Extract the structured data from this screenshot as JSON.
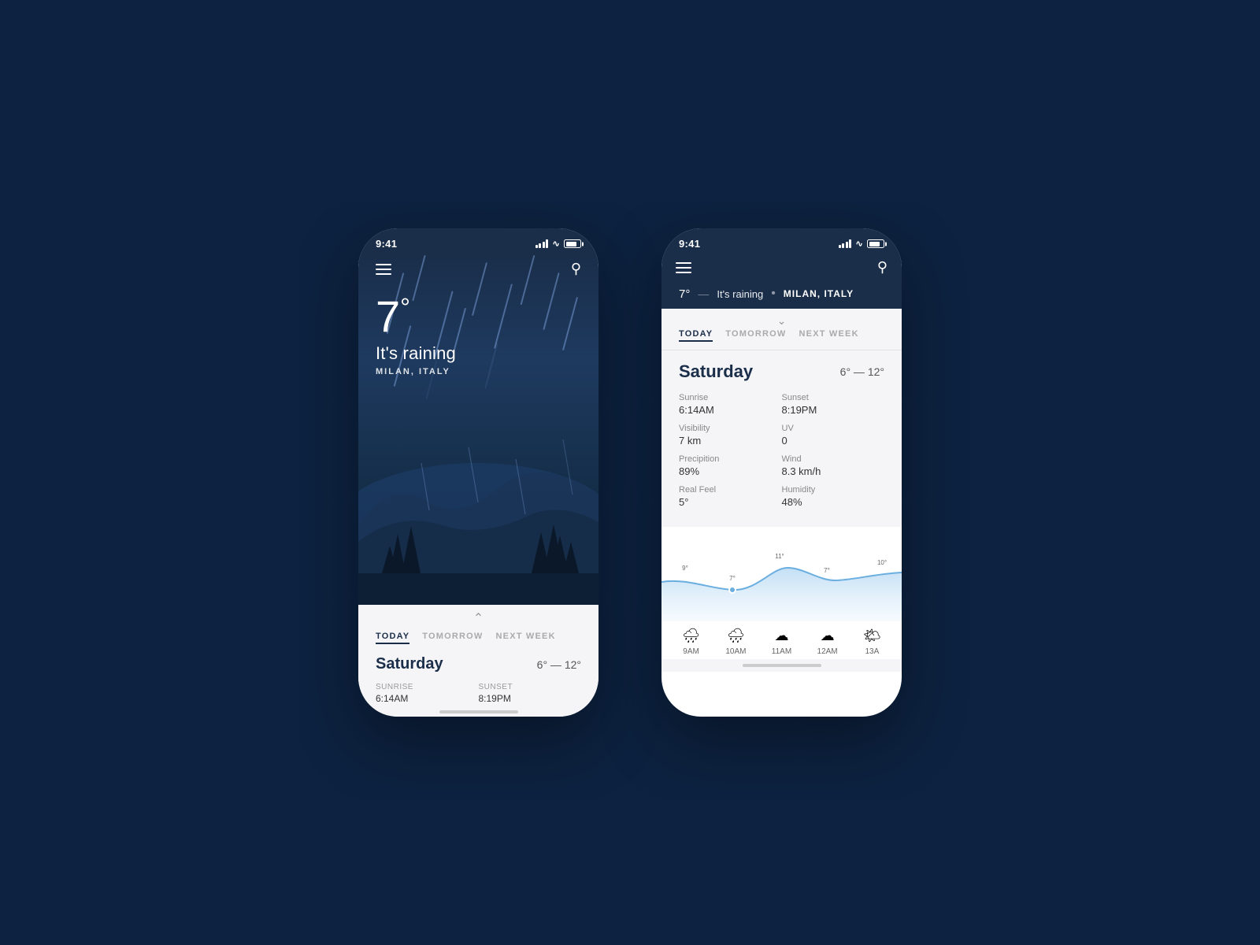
{
  "background_color": "#0d2240",
  "phones": {
    "left": {
      "status_bar": {
        "time": "9:41",
        "signal_bars": 4,
        "wifi": true,
        "battery": 80
      },
      "nav": {
        "menu_label": "menu",
        "search_label": "search"
      },
      "weather": {
        "temperature": "7",
        "degree_symbol": "°",
        "condition": "It's raining",
        "location": "MILAN, ITALY"
      },
      "panel": {
        "tabs": [
          {
            "label": "TODAY",
            "active": true
          },
          {
            "label": "TOMORROW",
            "active": false
          },
          {
            "label": "NEXT WEEK",
            "active": false
          }
        ],
        "day": "Saturday",
        "temp_range": "6° — 12°",
        "details": [
          {
            "label": "Sunrise",
            "value": "6:14AM"
          },
          {
            "label": "Sunset",
            "value": "8:19PM"
          }
        ]
      }
    },
    "right": {
      "status_bar": {
        "time": "9:41",
        "signal_bars": 4,
        "wifi": true,
        "battery": 80
      },
      "header": {
        "temperature": "7°",
        "separator": "—",
        "condition": "It's raining",
        "dot": "•",
        "location": "MILAN, ITALY"
      },
      "nav": {
        "menu_label": "menu",
        "search_label": "search"
      },
      "tabs": [
        {
          "label": "TODAY",
          "active": true
        },
        {
          "label": "TOMORROW",
          "active": false
        },
        {
          "label": "NEXT WEEK",
          "active": false
        }
      ],
      "day": "Saturday",
      "temp_range": "6° — 12°",
      "details": [
        {
          "label": "Sunrise",
          "value": "6:14AM",
          "label2": "Sunset",
          "value2": "8:19PM"
        },
        {
          "label": "Visibility",
          "value": "7 km",
          "label2": "UV",
          "value2": "0"
        },
        {
          "label": "Precipition",
          "value": "89%",
          "label2": "Wind",
          "value2": "8.3 km/h"
        },
        {
          "label": "Real Feel",
          "value": "5°",
          "label2": "Humidity",
          "value2": "48%"
        }
      ],
      "chart": {
        "points": [
          {
            "time": "9AM",
            "temp": 9
          },
          {
            "time": "10AM",
            "temp": 7
          },
          {
            "time": "11AM",
            "temp": 11
          },
          {
            "time": "12AM",
            "temp": 7
          },
          {
            "time": "13A",
            "temp": 10
          }
        ]
      },
      "hourly": [
        {
          "time": "9AM",
          "icon": "rain"
        },
        {
          "time": "10AM",
          "icon": "rain"
        },
        {
          "time": "11AM",
          "icon": "cloudy"
        },
        {
          "time": "12AM",
          "icon": "cloudy"
        },
        {
          "time": "13A",
          "icon": "partly-cloudy"
        }
      ]
    }
  }
}
